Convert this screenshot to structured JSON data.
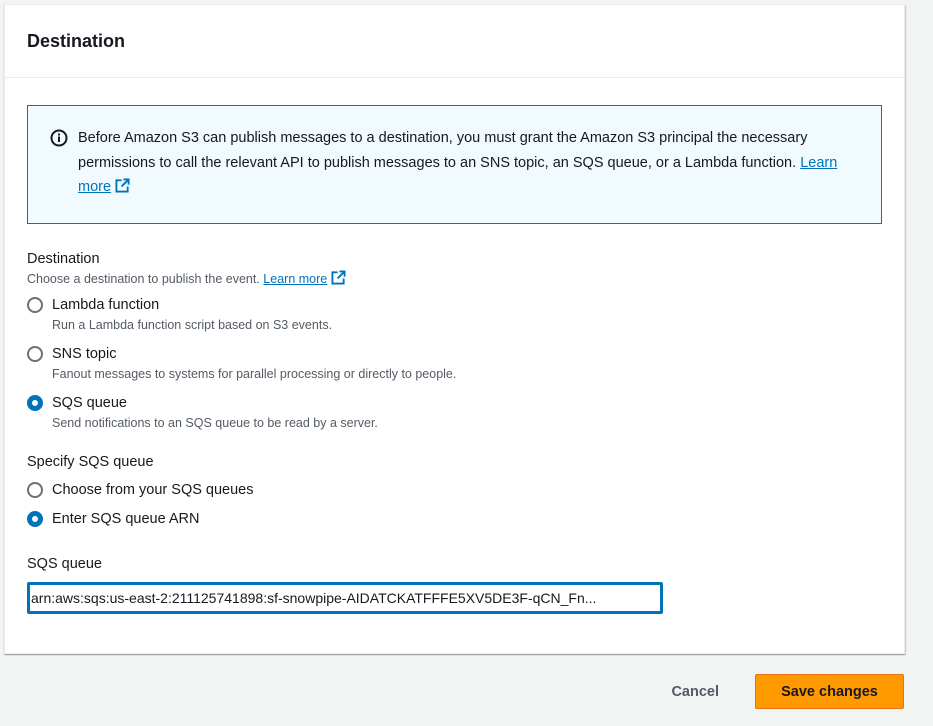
{
  "panel": {
    "title": "Destination"
  },
  "info": {
    "text": "Before Amazon S3 can publish messages to a destination, you must grant the Amazon S3 principal the necessary permissions to call the relevant API to publish messages to an SNS topic, an SQS queue, or a Lambda function.",
    "link": "Learn more",
    "icon": "info-icon"
  },
  "destination": {
    "label": "Destination",
    "description": "Choose a destination to publish the event.",
    "link": "Learn more",
    "options": [
      {
        "label": "Lambda function",
        "description": "Run a Lambda function script based on S3 events.",
        "checked": false
      },
      {
        "label": "SNS topic",
        "description": "Fanout messages to systems for parallel processing or directly to people.",
        "checked": false
      },
      {
        "label": "SQS queue",
        "description": "Send notifications to an SQS queue to be read by a server.",
        "checked": true
      }
    ]
  },
  "specify_sqs": {
    "label": "Specify SQS queue",
    "options": [
      {
        "label": "Choose from your SQS queues",
        "checked": false
      },
      {
        "label": "Enter SQS queue ARN",
        "checked": true
      }
    ]
  },
  "sqs_queue": {
    "label": "SQS queue",
    "value": "arn:aws:sqs:us-east-2:211125741898:sf-snowpipe-AIDATCKATFFFE5XV5DE3F-qCN_Fn..."
  },
  "footer": {
    "cancel_label": "Cancel",
    "save_label": "Save changes"
  },
  "colors": {
    "accent": "#0073bb",
    "primary_button": "#ff9900",
    "info_border": "#0b7c8f",
    "info_background": "#f1faff"
  }
}
